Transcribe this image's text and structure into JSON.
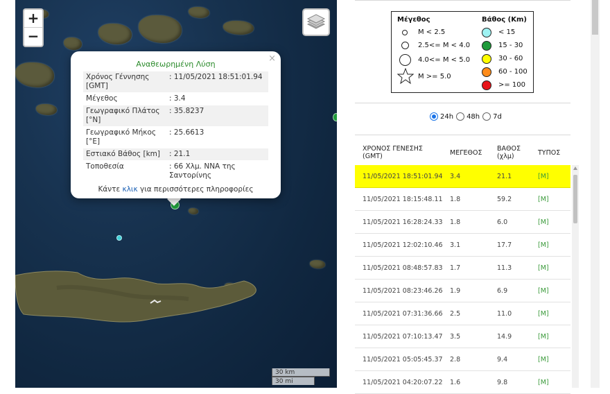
{
  "map": {
    "zoom_in_label": "+",
    "zoom_out_label": "−",
    "layers_icon": "layers-icon",
    "scale": {
      "km": "30 km",
      "mi": "30 mi"
    },
    "popup": {
      "title": "Αναθεωρημένη Λύση",
      "close": "×",
      "rows": [
        {
          "label": "Χρόνος Γέννησης [GMT]",
          "value": ": 11/05/2021 18:51:01.94"
        },
        {
          "label": "Μέγεθος",
          "value": ": 3.4"
        },
        {
          "label": "Γεωγραφικό Πλάτος [°N]",
          "value": ": 35.8237"
        },
        {
          "label": "Γεωγραφικό Μήκος [°E]",
          "value": ": 25.6613"
        },
        {
          "label": "Εστιακό Βάθος [km]",
          "value": ": 21.1"
        },
        {
          "label": "Τοποθεσία",
          "value": ": 66 Χλμ. ΝΝΑ της Σαντορίνης"
        }
      ],
      "more_prefix": "Κάντε ",
      "more_link": "κλικ",
      "more_suffix": " για περισσότερες πληροφορίες"
    }
  },
  "legend": {
    "magnitude_title": "Μέγεθος",
    "magnitude_items": [
      "M < 2.5",
      "2.5<= M < 4.0",
      "4.0<= M < 5.0",
      "M >= 5.0"
    ],
    "depth_title": "Βάθος (Km)",
    "depth_items": [
      {
        "label": "< 15",
        "color": "#9ff3f3"
      },
      {
        "label": "15 - 30",
        "color": "#1f9a3a"
      },
      {
        "label": "30 - 60",
        "color": "#ffff00"
      },
      {
        "label": "60 - 100",
        "color": "#ff8c1a"
      },
      {
        "label": ">= 100",
        "color": "#e8141a"
      }
    ]
  },
  "period": {
    "options": [
      "24h",
      "48h",
      "7d"
    ],
    "selected": "24h"
  },
  "table": {
    "headers": {
      "time": "ΧΡΟΝΟΣ ΓΕΝΕΣΗΣ (GMT)",
      "time_l1": "ΧΡΟΝΟΣ ΓΕΝΕΣΗΣ",
      "time_l2": "(GMT)",
      "mag": "ΜΕΓΕΘΟΣ",
      "depth_l1": "ΒΑΘΟΣ",
      "depth_l2": "(χλμ)",
      "type": "ΤΥΠΟΣ"
    },
    "rows": [
      {
        "time": "11/05/2021 18:51:01.94",
        "mag": "3.4",
        "depth": "21.1",
        "type": "[M]"
      },
      {
        "time": "11/05/2021 18:15:48.11",
        "mag": "1.8",
        "depth": "59.2",
        "type": "[M]"
      },
      {
        "time": "11/05/2021 16:28:24.33",
        "mag": "1.8",
        "depth": "6.0",
        "type": "[M]"
      },
      {
        "time": "11/05/2021 12:02:10.46",
        "mag": "3.1",
        "depth": "17.7",
        "type": "[M]"
      },
      {
        "time": "11/05/2021 08:48:57.83",
        "mag": "1.7",
        "depth": "11.3",
        "type": "[M]"
      },
      {
        "time": "11/05/2021 08:23:46.26",
        "mag": "1.9",
        "depth": "6.9",
        "type": "[M]"
      },
      {
        "time": "11/05/2021 07:31:36.66",
        "mag": "2.5",
        "depth": "11.0",
        "type": "[M]"
      },
      {
        "time": "11/05/2021 07:10:13.47",
        "mag": "3.5",
        "depth": "14.9",
        "type": "[M]"
      },
      {
        "time": "11/05/2021 05:05:45.37",
        "mag": "2.8",
        "depth": "9.4",
        "type": "[M]"
      },
      {
        "time": "11/05/2021 04:20:07.22",
        "mag": "1.6",
        "depth": "9.8",
        "type": "[M]"
      }
    ],
    "highlight_color": "#ffff00"
  }
}
